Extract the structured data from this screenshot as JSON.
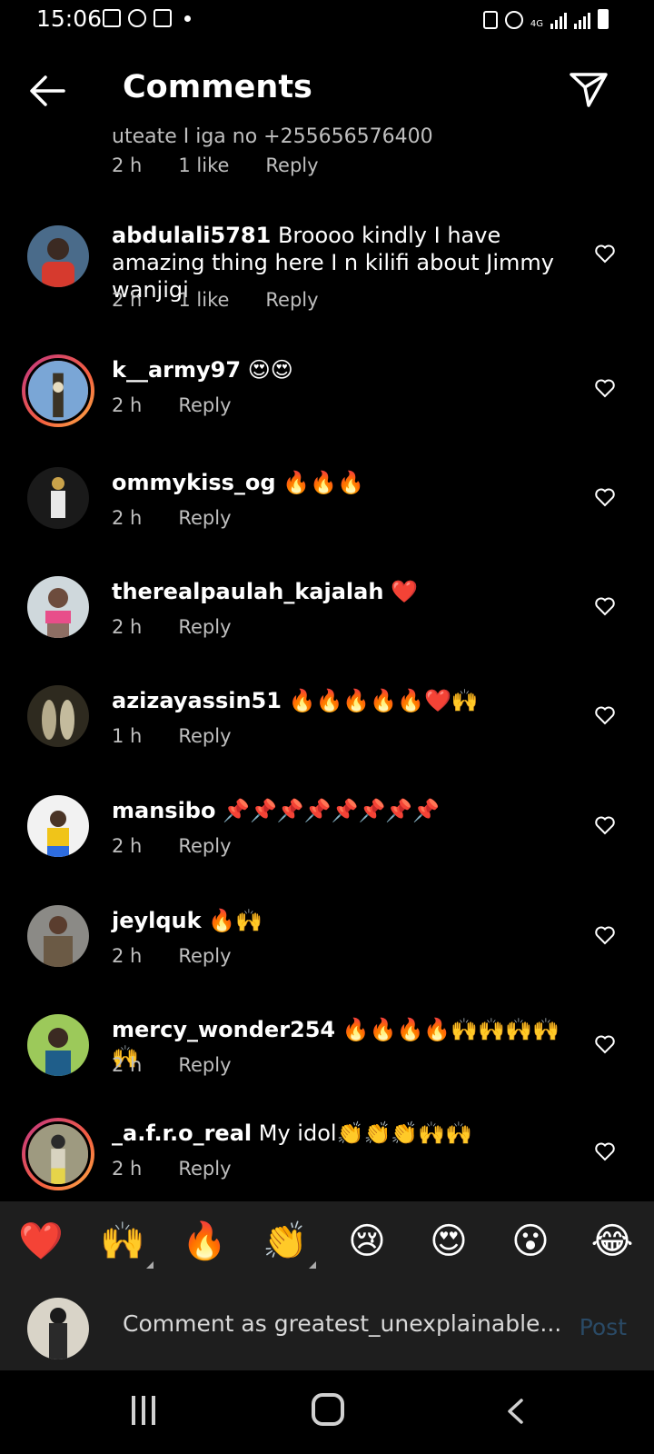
{
  "status": {
    "time": "15:06",
    "network": "4G"
  },
  "header": {
    "title": "Comments"
  },
  "partial": {
    "text": "uteate I iga no +255656576400",
    "time": "2 h",
    "likes": "1 like",
    "reply": "Reply"
  },
  "comments": [
    {
      "user": "abdulali5781",
      "text": "Broooo kindly I have amazing thing here I n kilifi about Jimmy wanjigi",
      "time": "2 h",
      "likes": "1 like",
      "reply": "Reply"
    },
    {
      "user": "k__army97",
      "text": "😍😍",
      "time": "2 h",
      "reply": "Reply"
    },
    {
      "user": "ommykiss_og",
      "text": "🔥🔥🔥",
      "time": "2 h",
      "reply": "Reply"
    },
    {
      "user": "therealpaulah_kajalah",
      "text": "❤️",
      "time": "2 h",
      "reply": "Reply"
    },
    {
      "user": "azizayassin51",
      "text": "🔥🔥🔥🔥🔥❤️🙌",
      "time": "1 h",
      "reply": "Reply"
    },
    {
      "user": "mansibo",
      "text": "📌📌📌📌📌📌📌📌",
      "time": "2 h",
      "reply": "Reply"
    },
    {
      "user": "jeylquk",
      "text": "🔥🙌",
      "time": "2 h",
      "reply": "Reply"
    },
    {
      "user": "mercy_wonder254",
      "text": "🔥🔥🔥🔥🙌🙌🙌🙌🙌",
      "time": "2 h",
      "reply": "Reply"
    },
    {
      "user": "_a.f.r.o_real",
      "text": "My idol👏👏👏🙌🙌",
      "time": "2 h",
      "reply": "Reply"
    }
  ],
  "emoji_bar": [
    "❤️",
    "🙌",
    "🔥",
    "👏",
    "😢",
    "😍",
    "😮",
    "😂"
  ],
  "composer": {
    "placeholder": "Comment as greatest_unexplainable...",
    "post_label": "Post"
  },
  "colors": {
    "background": "#000000",
    "meta": "#bfbfbf",
    "post_disabled": "#2a4a66",
    "story_ring": "#c13584"
  },
  "icons": {
    "back": "arrow-left-icon",
    "send": "paper-plane-icon",
    "like": "heart-outline-icon"
  }
}
